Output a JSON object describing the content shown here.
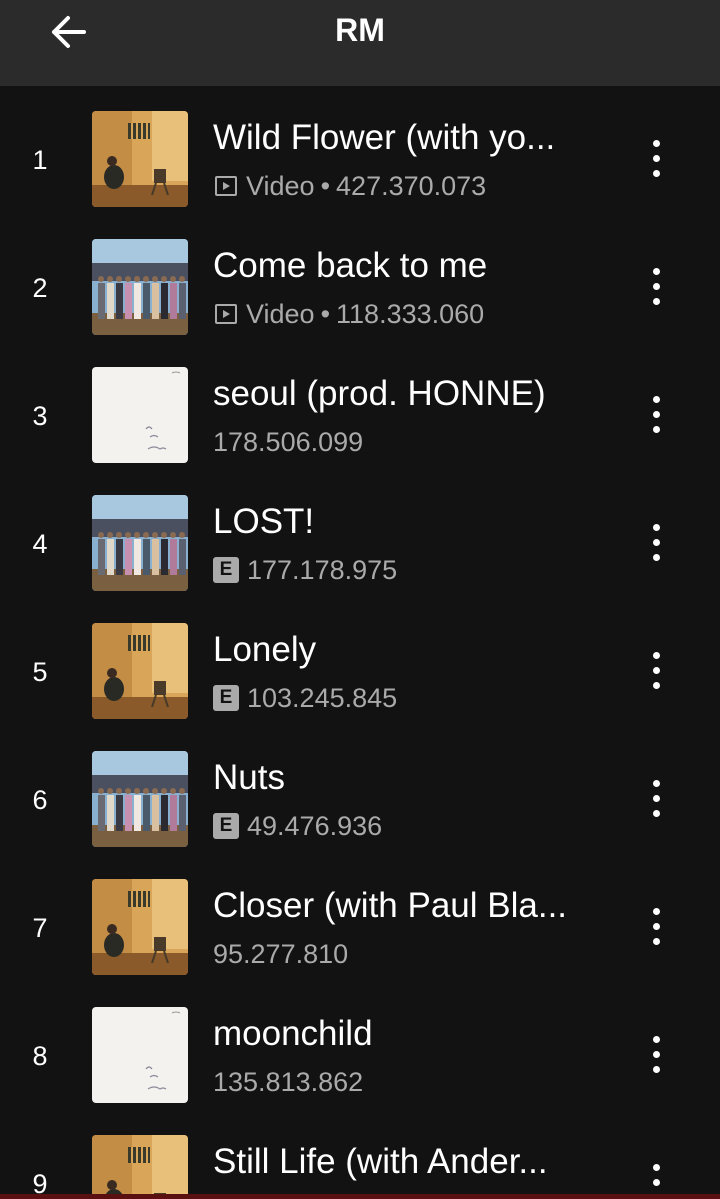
{
  "header": {
    "title": "RM",
    "back_icon": "arrow-left-icon"
  },
  "tracks": [
    {
      "rank": "1",
      "title": "Wild Flower (with yo...",
      "type": "Video",
      "plays": "427.370.073",
      "explicit": false,
      "video": true,
      "art": "warm-room"
    },
    {
      "rank": "2",
      "title": "Come back to me",
      "type": "Video",
      "plays": "118.333.060",
      "explicit": false,
      "video": true,
      "art": "group-sky"
    },
    {
      "rank": "3",
      "title": "seoul (prod. HONNE)",
      "type": "",
      "plays": "178.506.099",
      "explicit": false,
      "video": false,
      "art": "white-note"
    },
    {
      "rank": "4",
      "title": "LOST!",
      "type": "",
      "plays": "177.178.975",
      "explicit": true,
      "video": false,
      "art": "group-sky"
    },
    {
      "rank": "5",
      "title": "Lonely",
      "type": "",
      "plays": "103.245.845",
      "explicit": true,
      "video": false,
      "art": "warm-room"
    },
    {
      "rank": "6",
      "title": "Nuts",
      "type": "",
      "plays": "49.476.936",
      "explicit": true,
      "video": false,
      "art": "group-sky"
    },
    {
      "rank": "7",
      "title": "Closer (with Paul Bla...",
      "type": "",
      "plays": "95.277.810",
      "explicit": false,
      "video": false,
      "art": "warm-room"
    },
    {
      "rank": "8",
      "title": "moonchild",
      "type": "",
      "plays": "135.813.862",
      "explicit": false,
      "video": false,
      "art": "white-note"
    },
    {
      "rank": "9",
      "title": "Still Life (with Ander...",
      "type": "",
      "plays": "",
      "explicit": false,
      "video": false,
      "art": "warm-room"
    }
  ],
  "explicit_label": "E",
  "meta_separator": "•",
  "colors": {
    "background": "#121212",
    "header": "#2b2b2b",
    "secondary_text": "#aaaaaa",
    "accent_bar": "#5a1010"
  }
}
